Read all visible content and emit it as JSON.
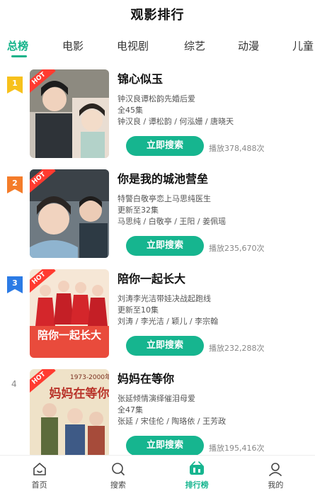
{
  "page_title": "观影排行",
  "tabs": [
    "总榜",
    "电影",
    "电视剧",
    "综艺",
    "动漫",
    "儿童"
  ],
  "active_tab": 0,
  "hot_label": "HOT",
  "search_label": "立即搜索",
  "items": [
    {
      "rank": "1",
      "title": "锦心似玉",
      "desc": "钟汉良谭松韵先婚后爱",
      "episodes": "全45集",
      "cast": "钟汉良 / 谭松韵 / 何泓姗 / 唐晓天",
      "plays": "播放378,488次",
      "badge_color": "#f7c11c"
    },
    {
      "rank": "2",
      "title": "你是我的城池营垒",
      "desc": "特警白敬亭恋上马思纯医生",
      "episodes": "更新至32集",
      "cast": "马思纯 / 白敬亭 / 王阳 / 姜佩瑶",
      "plays": "播放235,670次",
      "badge_color": "#f47c2a"
    },
    {
      "rank": "3",
      "title": "陪你一起长大",
      "desc": "刘涛李光洁带娃决战起跑线",
      "episodes": "更新至10集",
      "cast": "刘涛 / 李光洁 / 颖儿 / 李宗翰",
      "plays": "播放232,288次",
      "badge_color": "#2c7be5"
    },
    {
      "rank": "4",
      "title": "妈妈在等你",
      "desc": "张延倾情演绎催泪母爱",
      "episodes": "全47集",
      "cast": "张延 / 宋佳伦 / 陶珞依 / 王芳政",
      "plays": "播放195,416次",
      "poster_text": "1973-2000年",
      "badge_color": ""
    }
  ],
  "poster3_text": "陪你一起长大",
  "poster4_text": "妈妈在等你",
  "nav": [
    {
      "label": "首页",
      "icon": "home-icon"
    },
    {
      "label": "搜索",
      "icon": "search-icon"
    },
    {
      "label": "排行榜",
      "icon": "ranking-icon"
    },
    {
      "label": "我的",
      "icon": "profile-icon"
    }
  ],
  "accent_color": "#16b58f"
}
